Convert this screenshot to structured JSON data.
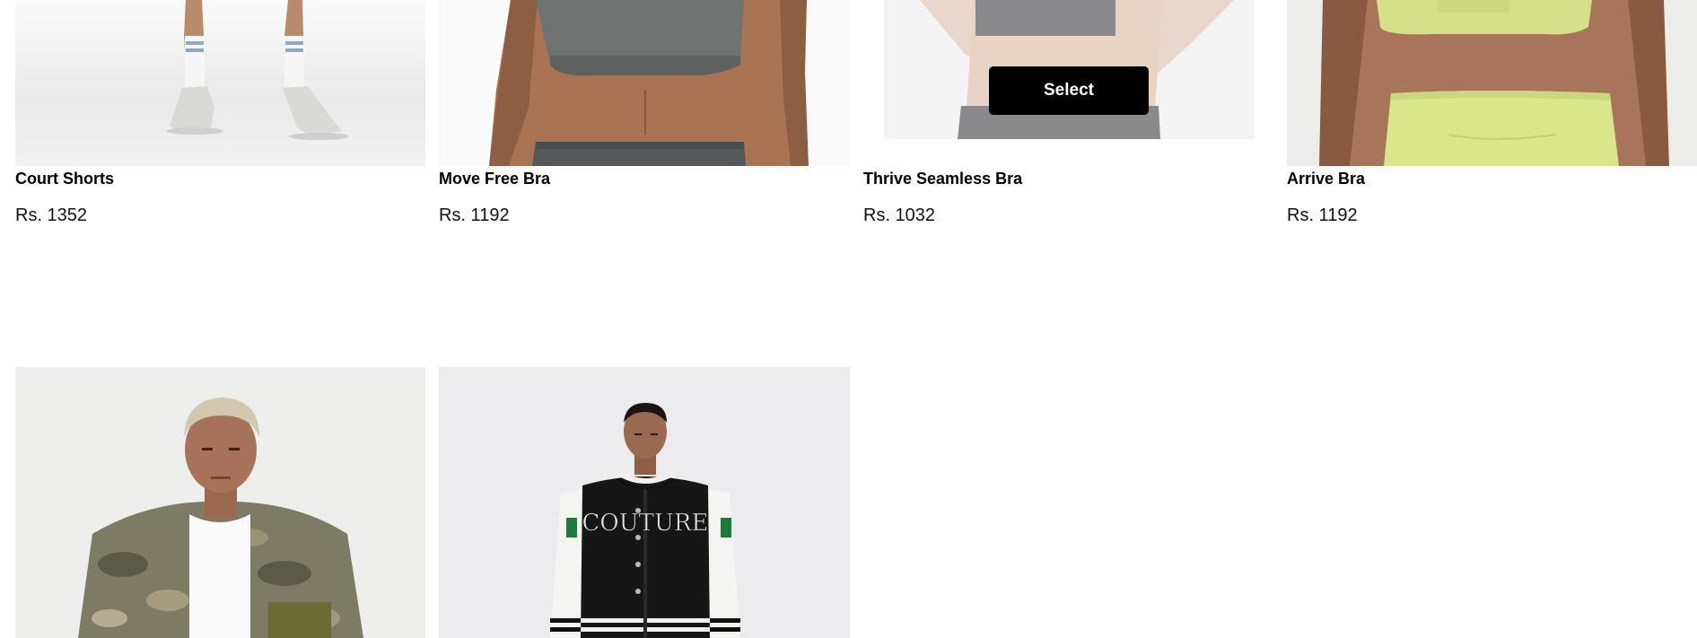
{
  "products": [
    {
      "title": "Court Shorts",
      "price": "Rs. 1352"
    },
    {
      "title": "Move Free Bra",
      "price": "Rs. 1192"
    },
    {
      "title": "Thrive Seamless Bra",
      "price": "Rs. 1032"
    },
    {
      "title": "Arrive Bra",
      "price": "Rs. 1192"
    }
  ],
  "row2_products": [
    {
      "image_text": "COUTURE"
    }
  ],
  "hover_action": {
    "label": "Select"
  },
  "colors": {
    "button_bg": "#000000",
    "button_text": "#ffffff",
    "image_bg": "#eeeeee"
  }
}
